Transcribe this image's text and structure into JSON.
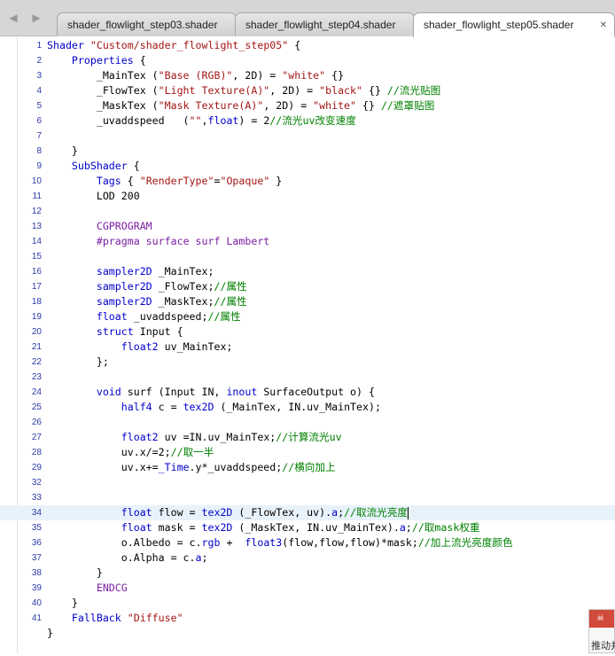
{
  "tabs": [
    {
      "label": "shader_flowlight_step03.shader"
    },
    {
      "label": "shader_flowlight_step04.shader"
    },
    {
      "label": "shader_flowlight_step05.shader"
    }
  ],
  "nav": {
    "back": "◀",
    "forward": "▶"
  },
  "popup": {
    "icon": "☠",
    "text": "推动并"
  },
  "code_lines": [
    [
      {
        "t": "Shader ",
        "c": "kw"
      },
      {
        "t": "\"Custom/shader_flowlight_step05\"",
        "c": "st"
      },
      {
        "t": " {",
        "c": ""
      }
    ],
    [
      {
        "t": "    ",
        "c": ""
      },
      {
        "t": "Properties",
        "c": "kw"
      },
      {
        "t": " {",
        "c": ""
      }
    ],
    [
      {
        "t": "        _MainTex (",
        "c": ""
      },
      {
        "t": "\"Base (RGB)\"",
        "c": "st"
      },
      {
        "t": ", 2D) = ",
        "c": ""
      },
      {
        "t": "\"white\"",
        "c": "st"
      },
      {
        "t": " {}",
        "c": ""
      }
    ],
    [
      {
        "t": "        _FlowTex (",
        "c": ""
      },
      {
        "t": "\"Light Texture(A)\"",
        "c": "st"
      },
      {
        "t": ", 2D) = ",
        "c": ""
      },
      {
        "t": "\"black\"",
        "c": "st"
      },
      {
        "t": " {} ",
        "c": ""
      },
      {
        "t": "//流光贴图",
        "c": "cm"
      }
    ],
    [
      {
        "t": "        _MaskTex (",
        "c": ""
      },
      {
        "t": "\"Mask Texture(A)\"",
        "c": "st"
      },
      {
        "t": ", 2D) = ",
        "c": ""
      },
      {
        "t": "\"white\"",
        "c": "st"
      },
      {
        "t": " {} ",
        "c": ""
      },
      {
        "t": "//遮罩贴图",
        "c": "cm"
      }
    ],
    [
      {
        "t": "        _uvaddspeed   (",
        "c": ""
      },
      {
        "t": "\"\"",
        "c": "st"
      },
      {
        "t": ",",
        "c": ""
      },
      {
        "t": "float",
        "c": "kw"
      },
      {
        "t": ") = 2",
        "c": ""
      },
      {
        "t": "//流光uv改变速度",
        "c": "cm"
      }
    ],
    [],
    [
      {
        "t": "    }",
        "c": ""
      }
    ],
    [
      {
        "t": "    ",
        "c": ""
      },
      {
        "t": "SubShader",
        "c": "kw"
      },
      {
        "t": " {",
        "c": ""
      }
    ],
    [
      {
        "t": "        ",
        "c": ""
      },
      {
        "t": "Tags",
        "c": "kw"
      },
      {
        "t": " { ",
        "c": ""
      },
      {
        "t": "\"RenderType\"",
        "c": "st"
      },
      {
        "t": "=",
        "c": ""
      },
      {
        "t": "\"Opaque\"",
        "c": "st"
      },
      {
        "t": " }",
        "c": ""
      }
    ],
    [
      {
        "t": "        LOD 200",
        "c": ""
      }
    ],
    [],
    [
      {
        "t": "        ",
        "c": ""
      },
      {
        "t": "CGPROGRAM",
        "c": "pp"
      }
    ],
    [
      {
        "t": "        ",
        "c": ""
      },
      {
        "t": "#pragma surface surf Lambert",
        "c": "pp"
      }
    ],
    [],
    [
      {
        "t": "        ",
        "c": ""
      },
      {
        "t": "sampler2D",
        "c": "kw"
      },
      {
        "t": " _MainTex;",
        "c": ""
      }
    ],
    [
      {
        "t": "        ",
        "c": ""
      },
      {
        "t": "sampler2D",
        "c": "kw"
      },
      {
        "t": " _FlowTex;",
        "c": ""
      },
      {
        "t": "//属性",
        "c": "cm"
      }
    ],
    [
      {
        "t": "        ",
        "c": ""
      },
      {
        "t": "sampler2D",
        "c": "kw"
      },
      {
        "t": " _MaskTex;",
        "c": ""
      },
      {
        "t": "//属性",
        "c": "cm"
      }
    ],
    [
      {
        "t": "        ",
        "c": ""
      },
      {
        "t": "float",
        "c": "kw"
      },
      {
        "t": " _uvaddspeed;",
        "c": ""
      },
      {
        "t": "//属性",
        "c": "cm"
      }
    ],
    [
      {
        "t": "        ",
        "c": ""
      },
      {
        "t": "struct",
        "c": "kw"
      },
      {
        "t": " Input {",
        "c": ""
      }
    ],
    [
      {
        "t": "            ",
        "c": ""
      },
      {
        "t": "float2",
        "c": "kw"
      },
      {
        "t": " uv_MainTex;",
        "c": ""
      }
    ],
    [
      {
        "t": "        };",
        "c": ""
      }
    ],
    [],
    [
      {
        "t": "        ",
        "c": ""
      },
      {
        "t": "void",
        "c": "kw"
      },
      {
        "t": " surf (Input IN, ",
        "c": ""
      },
      {
        "t": "inout",
        "c": "kw"
      },
      {
        "t": " SurfaceOutput o) {",
        "c": ""
      }
    ],
    [
      {
        "t": "            ",
        "c": ""
      },
      {
        "t": "half4",
        "c": "kw"
      },
      {
        "t": " c = ",
        "c": ""
      },
      {
        "t": "tex2D",
        "c": "kw"
      },
      {
        "t": " (_MainTex, IN.uv_MainTex);",
        "c": ""
      }
    ],
    [],
    [
      {
        "t": "            ",
        "c": ""
      },
      {
        "t": "float2",
        "c": "kw"
      },
      {
        "t": " uv =IN.uv_MainTex;",
        "c": ""
      },
      {
        "t": "//计算流光uv",
        "c": "cm"
      }
    ],
    [
      {
        "t": "            uv.x/=2;",
        "c": ""
      },
      {
        "t": "//取一半",
        "c": "cm"
      }
    ],
    [
      {
        "t": "            uv.x+=",
        "c": ""
      },
      {
        "t": "_Time",
        "c": "kw"
      },
      {
        "t": ".y*_uvaddspeed;",
        "c": ""
      },
      {
        "t": "//横向加上",
        "c": "cm"
      }
    ],
    [],
    [],
    [
      {
        "t": "            ",
        "c": ""
      },
      {
        "t": "float",
        "c": "kw"
      },
      {
        "t": " flow = ",
        "c": ""
      },
      {
        "t": "tex2D",
        "c": "kw"
      },
      {
        "t": " (_FlowTex, uv).",
        "c": ""
      },
      {
        "t": "a",
        "c": "kw"
      },
      {
        "t": ";",
        "c": ""
      },
      {
        "t": "//取流光亮度",
        "c": "cm"
      }
    ],
    [
      {
        "t": "            ",
        "c": ""
      },
      {
        "t": "float",
        "c": "kw"
      },
      {
        "t": " mask = ",
        "c": ""
      },
      {
        "t": "tex2D",
        "c": "kw"
      },
      {
        "t": " (_MaskTex, IN.uv_MainTex).",
        "c": ""
      },
      {
        "t": "a",
        "c": "kw"
      },
      {
        "t": ";",
        "c": ""
      },
      {
        "t": "//取mask权重",
        "c": "cm"
      }
    ],
    [
      {
        "t": "            o.Albedo = c.",
        "c": ""
      },
      {
        "t": "rgb",
        "c": "kw"
      },
      {
        "t": " +  ",
        "c": ""
      },
      {
        "t": "float3",
        "c": "kw"
      },
      {
        "t": "(flow,flow,flow)*mask;",
        "c": ""
      },
      {
        "t": "//加上流光亮度颜色",
        "c": "cm"
      }
    ],
    [
      {
        "t": "            o.Alpha = c.",
        "c": ""
      },
      {
        "t": "a",
        "c": "kw"
      },
      {
        "t": ";",
        "c": ""
      }
    ],
    [
      {
        "t": "        }",
        "c": ""
      }
    ],
    [
      {
        "t": "        ",
        "c": ""
      },
      {
        "t": "ENDCG",
        "c": "pp"
      }
    ],
    [
      {
        "t": "    }",
        "c": ""
      }
    ],
    [
      {
        "t": "    ",
        "c": ""
      },
      {
        "t": "FallBack",
        "c": "kw"
      },
      {
        "t": " ",
        "c": ""
      },
      {
        "t": "\"Diffuse\"",
        "c": "st"
      }
    ],
    [
      {
        "t": "}",
        "c": ""
      }
    ],
    []
  ],
  "line_numbers": [
    "1",
    "2",
    "3",
    "4",
    "5",
    "6",
    "7",
    "8",
    "9",
    "10",
    "11",
    "12",
    "13",
    "14",
    "15",
    "16",
    "17",
    "18",
    "19",
    "20",
    "21",
    "22",
    "23",
    "24",
    "25",
    "26",
    "27",
    "28",
    "29",
    "32",
    "33",
    "34",
    "35",
    "36",
    "37",
    "38",
    "39",
    "40",
    "41"
  ],
  "current_line": "34"
}
